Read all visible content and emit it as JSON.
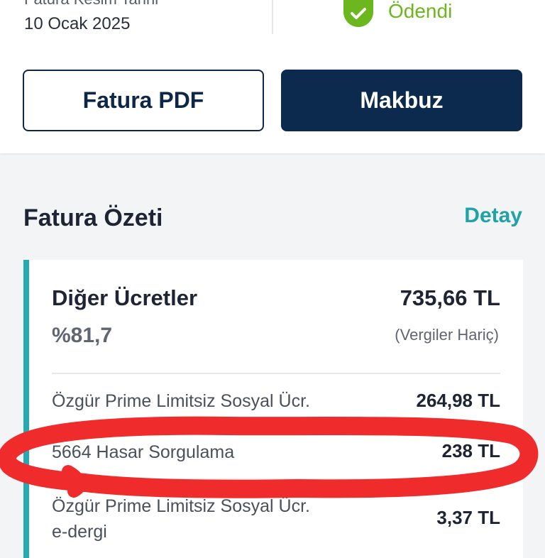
{
  "invoice": {
    "date_label": "Fatura Kesim Tarihi",
    "date_value": "10 Ocak 2025",
    "status_icon": "check-circle-icon",
    "status_text": "Ödendi",
    "status_color": "#6cb61e"
  },
  "actions": {
    "pdf_label": "Fatura PDF",
    "receipt_label": "Makbuz"
  },
  "summary": {
    "title": "Fatura Özeti",
    "detail_link": "Detay",
    "accent_color": "#25a9b2",
    "card": {
      "title": "Diğer Ücretler",
      "amount": "735,66 TL",
      "percent": "%81,7",
      "note": "(Vergiler Hariç)"
    },
    "rows": [
      {
        "label": "Özgür  Prime Limitsiz Sosyal Ücr.",
        "value": "264,98 TL"
      },
      {
        "label": "5664 Hasar Sorgulama",
        "value": "238 TL"
      },
      {
        "label": "Özgür  Prime Limitsiz Sosyal Ücr.",
        "label_line2": "e-dergi",
        "value": "3,37 TL"
      }
    ]
  },
  "annotation_color": "#f02b2b"
}
